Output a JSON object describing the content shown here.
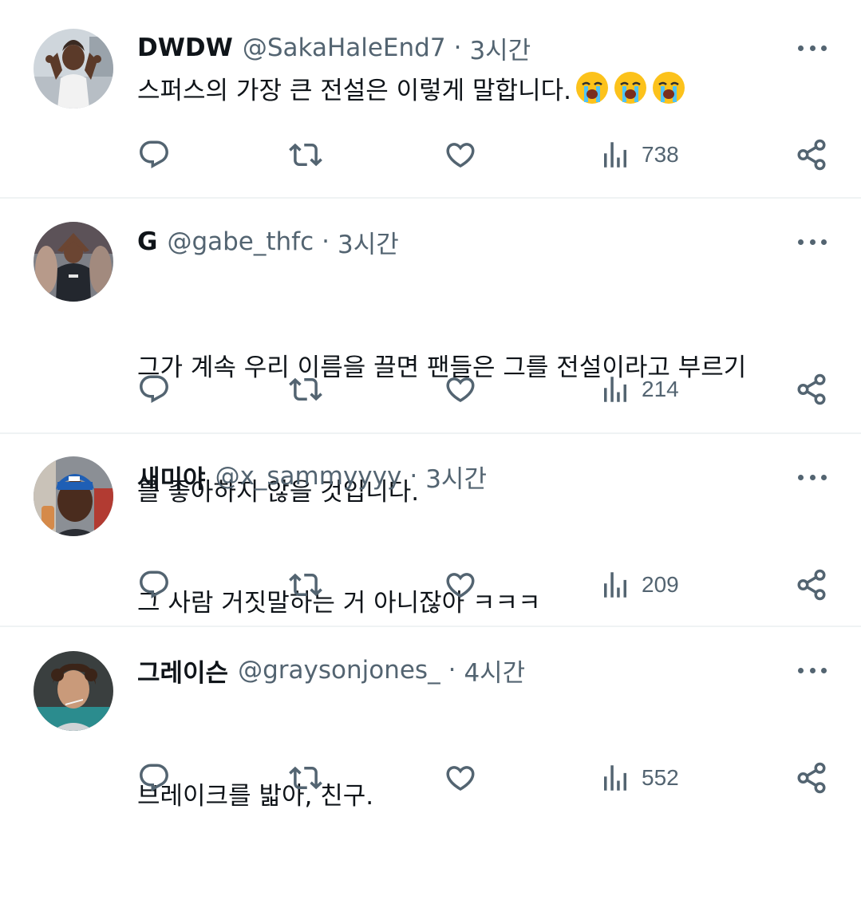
{
  "tweets": [
    {
      "name": "DWDW",
      "handle": "@SakaHaleEnd7",
      "dot": "·",
      "time": "3시간",
      "text": "스퍼스의 가장 큰 전설은 이렇게 말합니다.",
      "emojis": [
        "crying-face",
        "crying-face",
        "crying-face"
      ],
      "views": "738"
    },
    {
      "name": "G",
      "handle": "@gabe_thfc",
      "dot": "·",
      "time": "3시간",
      "text_line1": "그가 계속 우리 이름을 끌면 팬들은 그를 전설이라고 부르기",
      "text_line2": "를 좋아하지 않을 것입니다.",
      "views": "214"
    },
    {
      "name": "새미야",
      "handle": "@x_sammyyyy",
      "dot": "·",
      "time": "3시간",
      "text": "그 사람 거짓말하는 거 아니잖아 ㅋㅋㅋ",
      "views": "209"
    },
    {
      "name": "그레이슨",
      "handle": "@graysonjones_",
      "dot": "·",
      "time": "4시간",
      "text": "브레이크를 밟아, 친구.",
      "views": "552"
    }
  ],
  "icons": {
    "reply": "reply-icon",
    "retweet": "retweet-icon",
    "like": "heart-icon",
    "views": "views-icon",
    "share": "share-icon",
    "more": "more-icon"
  },
  "colors": {
    "text": "#0f1419",
    "secondary": "#536471",
    "divider": "#eff3f4"
  }
}
